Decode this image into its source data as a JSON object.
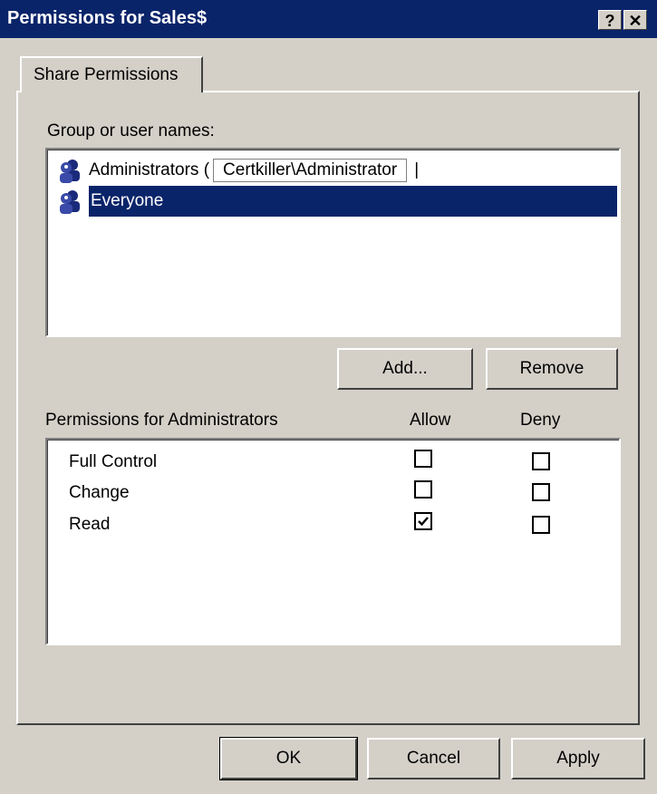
{
  "window": {
    "title": "Permissions for Sales$",
    "help_label": "?",
    "close_label": "✕"
  },
  "tabs": [
    {
      "label": "Share Permissions"
    }
  ],
  "group_list": {
    "label": "Group or user names:",
    "items": [
      {
        "label": "Administrators (",
        "callout": "Certkiller\\Administrator",
        "callout_end": "|",
        "icon": "users-icon",
        "selected": false
      },
      {
        "label": "Everyone",
        "icon": "users-icon",
        "selected": true
      }
    ]
  },
  "buttons": {
    "add": "Add...",
    "remove": "Remove",
    "ok": "OK",
    "cancel": "Cancel",
    "apply": "Apply"
  },
  "permissions": {
    "label": "Permissions for Administrators",
    "allow_header": "Allow",
    "deny_header": "Deny",
    "rows": [
      {
        "name": "Full Control",
        "allow": false,
        "deny": false
      },
      {
        "name": "Change",
        "allow": false,
        "deny": false
      },
      {
        "name": "Read",
        "allow": true,
        "deny": false
      }
    ]
  },
  "colors": {
    "titlebar": "#0a246a",
    "selection": "#0a246a",
    "face": "#d4d0c8"
  }
}
